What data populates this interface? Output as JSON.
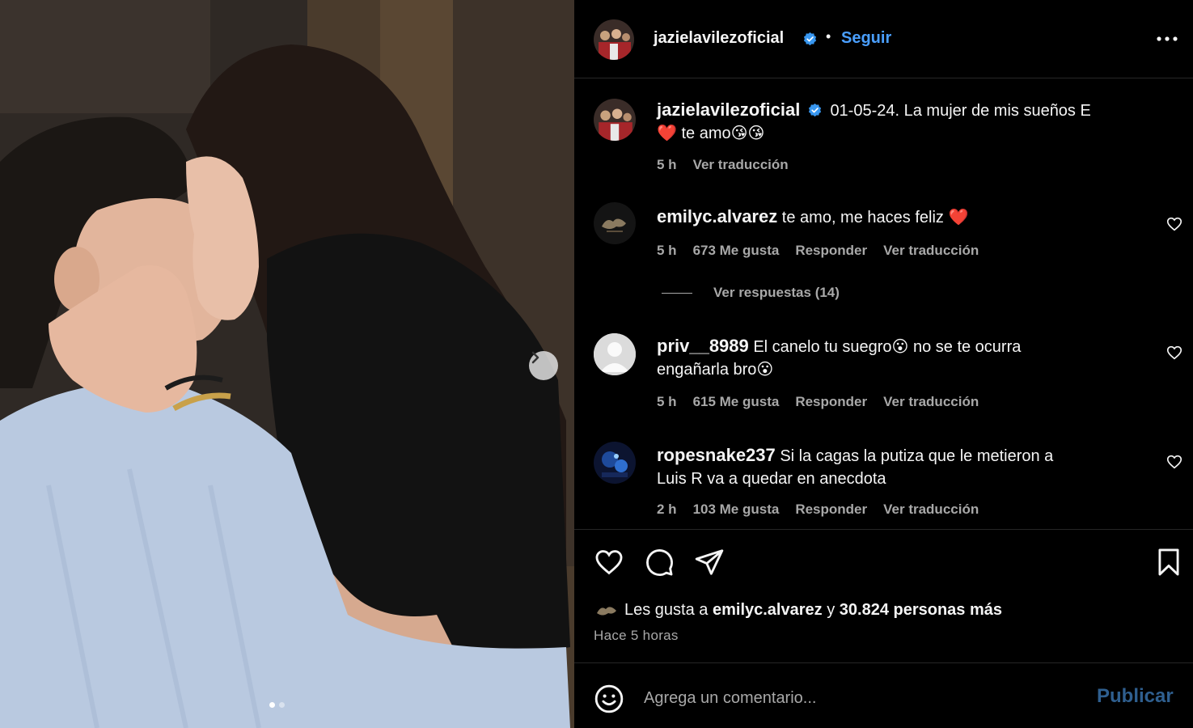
{
  "post": {
    "image_alt": "Pareja besándose",
    "carousel": {
      "total": 2,
      "current": 1
    }
  },
  "header": {
    "username": "jazielavilezoficial",
    "separator": "•",
    "follow_label": "Seguir"
  },
  "caption": {
    "username": "jazielavilezoficial",
    "text": "01-05-24. La mujer de mis sueños E",
    "text_line2": "❤️ te amo😘😘",
    "time": "5 h",
    "translate_label": "Ver traducción"
  },
  "comments": [
    {
      "username": "emilyc.alvarez",
      "text": "te amo, me haces feliz ❤️",
      "time": "5 h",
      "likes": "673 Me gusta",
      "reply_label": "Responder",
      "translate_label": "Ver traducción",
      "replies_label": "Ver respuestas (14)"
    },
    {
      "username": "priv__8989",
      "text": "El canelo tu suegro😮 no se te ocurra",
      "text_line2": "engañarla bro😮",
      "time": "5 h",
      "likes": "615 Me gusta",
      "reply_label": "Responder",
      "translate_label": "Ver traducción"
    },
    {
      "username": "ropesnake237",
      "text": "Si la cagas la putiza que le metieron a",
      "text_line2": "Luis R va a quedar en anecdota",
      "time": "2 h",
      "likes": "103 Me gusta",
      "reply_label": "Responder",
      "translate_label": "Ver traducción"
    }
  ],
  "likes": {
    "prefix": "Les gusta a",
    "user": "emilyc.alvarez",
    "conj": "y",
    "others": "30.824 personas más"
  },
  "posted_ago": "Hace 5 horas",
  "add_comment": {
    "placeholder": "Agrega un comentario...",
    "publish_label": "Publicar"
  },
  "colors": {
    "background": "#000000",
    "link_blue": "#4a9fff",
    "muted": "#a8a8a8",
    "publish_disabled": "#2f5f8f"
  }
}
